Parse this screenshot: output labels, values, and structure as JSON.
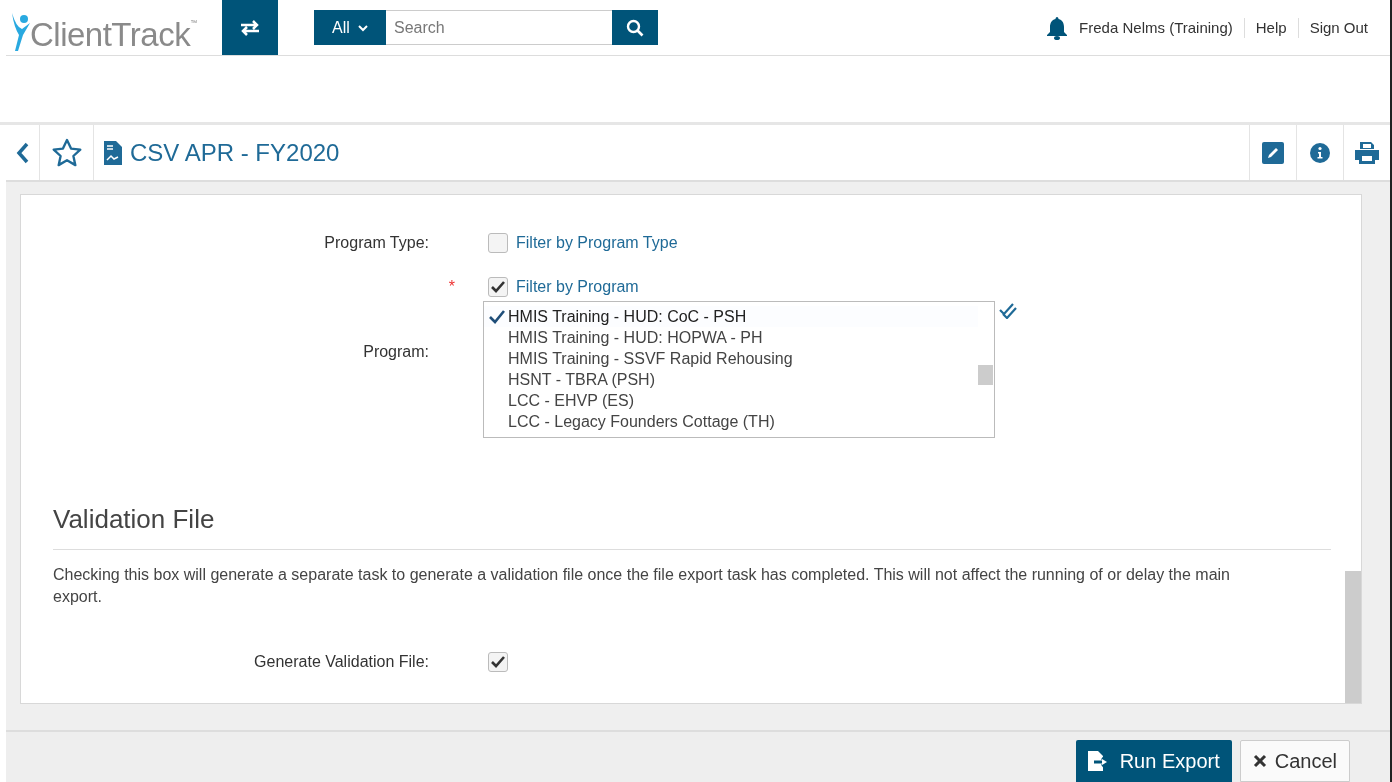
{
  "header": {
    "logo": "ClientTrack",
    "logo_mark": "™",
    "search": {
      "scope": "All",
      "placeholder": "Search"
    },
    "user": "Freda Nelms (Training)",
    "links": [
      "Help",
      "Sign Out"
    ]
  },
  "page": {
    "title": "CSV APR - FY2020",
    "favorite": false
  },
  "form": {
    "program_type": {
      "label": "Program Type:",
      "option": "Filter by Program Type",
      "checked": false
    },
    "program_filter": {
      "option": "Filter by Program",
      "checked": true,
      "required_mark": "*"
    },
    "program": {
      "label": "Program:",
      "items": [
        {
          "text": "HMIS Training - HUD: CoC - PSH",
          "selected": true
        },
        {
          "text": "HMIS Training - HUD: HOPWA - PH",
          "selected": false
        },
        {
          "text": "HMIS Training - SSVF Rapid Rehousing",
          "selected": false
        },
        {
          "text": "HSNT - TBRA (PSH)",
          "selected": false
        },
        {
          "text": "LCC - EHVP (ES)",
          "selected": false
        },
        {
          "text": "LCC - Legacy Founders Cottage (TH)",
          "selected": false
        }
      ]
    },
    "validation": {
      "heading": "Validation File",
      "description": "Checking this box will generate a separate task to generate a validation file once the file export task has completed. This will not affect the running of or delay the main export.",
      "label": "Generate Validation File:",
      "checked": true
    }
  },
  "footer": {
    "buttons": [
      {
        "label": "Run Export",
        "kind": "primary"
      },
      {
        "label": "Cancel",
        "kind": "secondary"
      }
    ]
  }
}
